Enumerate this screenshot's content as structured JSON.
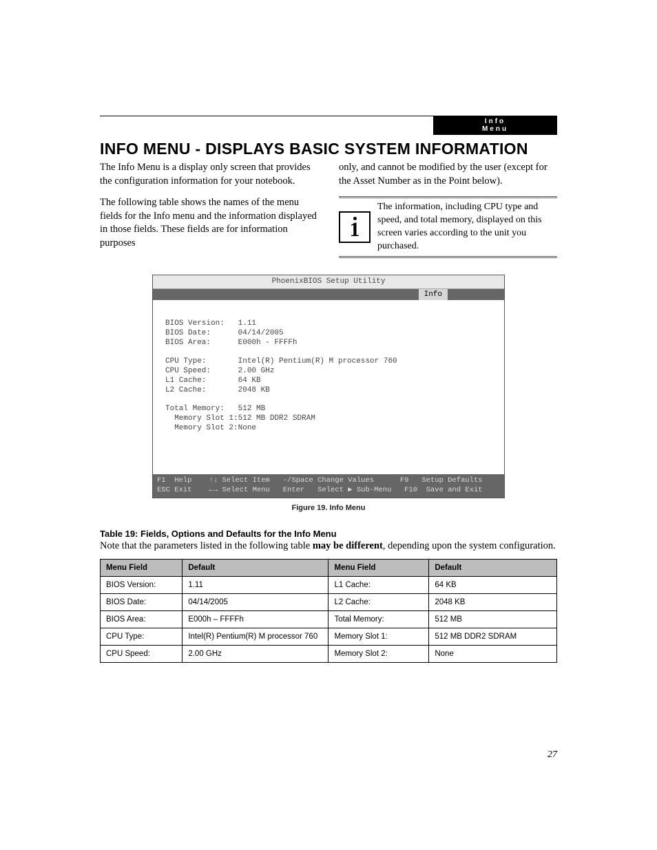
{
  "header": {
    "tag": "Info Menu"
  },
  "title": "INFO MENU - DISPLAYS BASIC SYSTEM INFORMATION",
  "intro": {
    "p1": "The Info Menu is a display only screen that provides the configuration information for your notebook.",
    "p2": "The following table shows the names of the menu fields for the Info menu and the information displayed in those fields. These fields are for information purposes",
    "p3": "only, and cannot be modified by the user (except for the Asset Number as in the Point below).",
    "noteText": "The information, including CPU type and speed, and total memory, displayed on this screen varies according to the unit you purchased."
  },
  "bios": {
    "windowTitle": "PhoenixBIOS Setup Utility",
    "activeTab": "Info",
    "rows": [
      {
        "label": "BIOS Version:",
        "value": "1.11"
      },
      {
        "label": "BIOS Date:",
        "value": "04/14/2005"
      },
      {
        "label": "BIOS Area:",
        "value": "E000h - FFFFh"
      },
      {
        "label": "",
        "value": ""
      },
      {
        "label": "CPU Type:",
        "value": "Intel(R) Pentium(R) M processor 760"
      },
      {
        "label": "CPU Speed:",
        "value": "2.00 GHz"
      },
      {
        "label": "L1 Cache:",
        "value": "64 KB"
      },
      {
        "label": "L2 Cache:",
        "value": "2048 KB"
      },
      {
        "label": "",
        "value": ""
      },
      {
        "label": "Total Memory:",
        "value": "512 MB"
      },
      {
        "label": "  Memory Slot 1:",
        "value": "512 MB DDR2 SDRAM"
      },
      {
        "label": "  Memory Slot 2:",
        "value": "None"
      }
    ],
    "footer": {
      "l1": "F1  Help    ↑↓ Select Item   -/Space Change Values      F9   Setup Defaults",
      "l2": "ESC Exit    ←→ Select Menu   Enter   Select ▶ Sub-Menu   F10  Save and Exit"
    }
  },
  "figCaption": "Figure 19.  Info Menu",
  "tableTitle": "Table 19: Fields, Options and Defaults for the Info Menu",
  "tableNotePrefix": "Note that the parameters listed in the following table ",
  "tableNoteEmph": "may be different",
  "tableNoteSuffix": ", depending upon the system configuration.",
  "tableHeaders": {
    "field": "Menu Field",
    "default": "Default"
  },
  "tableRows": [
    {
      "f1": "BIOS Version:",
      "d1": "1.11",
      "f2": "L1 Cache:",
      "d2": "64 KB"
    },
    {
      "f1": "BIOS Date:",
      "d1": "04/14/2005",
      "f2": "L2 Cache:",
      "d2": "2048 KB"
    },
    {
      "f1": "BIOS Area:",
      "d1": "E000h – FFFFh",
      "f2": "Total Memory:",
      "d2": "512 MB"
    },
    {
      "f1": "CPU Type:",
      "d1": "Intel(R) Pentium(R) M processor 760",
      "f2": "Memory Slot 1:",
      "d2": "512 MB DDR2 SDRAM"
    },
    {
      "f1": "CPU Speed:",
      "d1": "2.00 GHz",
      "f2": "Memory Slot 2:",
      "d2": "None"
    }
  ],
  "pageNumber": "27"
}
